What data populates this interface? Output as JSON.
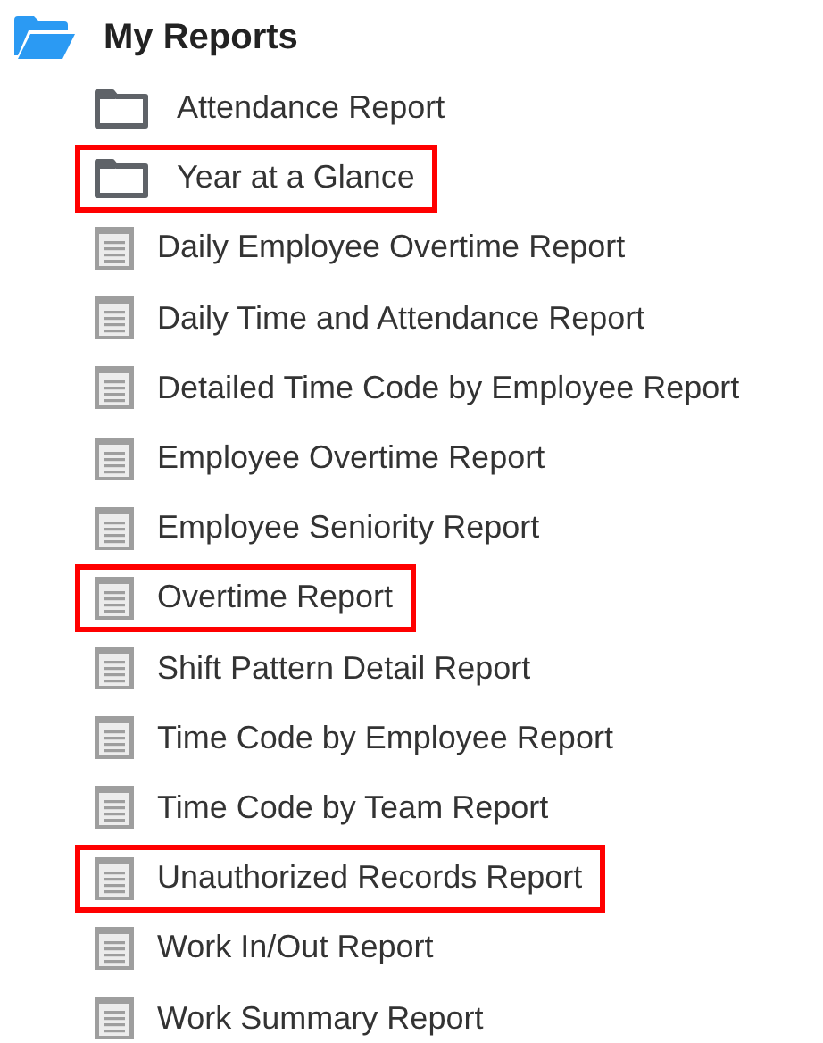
{
  "tree": {
    "label": "My Reports",
    "expanded": true,
    "children": [
      {
        "kind": "folder",
        "label": "Attendance Report",
        "highlighted": false
      },
      {
        "kind": "folder",
        "label": "Year at a Glance",
        "highlighted": true
      },
      {
        "kind": "report",
        "label": "Daily Employee Overtime Report",
        "highlighted": false
      },
      {
        "kind": "report",
        "label": "Daily Time and Attendance Report",
        "highlighted": false
      },
      {
        "kind": "report",
        "label": "Detailed Time Code by Employee Report",
        "highlighted": false
      },
      {
        "kind": "report",
        "label": "Employee Overtime Report",
        "highlighted": false
      },
      {
        "kind": "report",
        "label": "Employee Seniority Report",
        "highlighted": false
      },
      {
        "kind": "report",
        "label": "Overtime Report",
        "highlighted": true
      },
      {
        "kind": "report",
        "label": "Shift Pattern Detail Report",
        "highlighted": false
      },
      {
        "kind": "report",
        "label": "Time Code by Employee Report",
        "highlighted": false
      },
      {
        "kind": "report",
        "label": "Time Code by Team Report",
        "highlighted": false
      },
      {
        "kind": "report",
        "label": "Unauthorized Records Report",
        "highlighted": true
      },
      {
        "kind": "report",
        "label": "Work In/Out Report",
        "highlighted": false
      },
      {
        "kind": "report",
        "label": "Work Summary Report",
        "highlighted": false
      }
    ]
  }
}
